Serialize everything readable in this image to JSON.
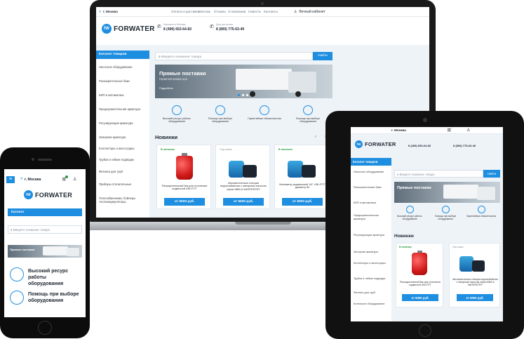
{
  "brand": {
    "logo_text": "FORWATER",
    "badge_text": "fW",
    "accent": "#1e8ee0",
    "green": "#2a9b42"
  },
  "laptop": {
    "city": "г. Москва",
    "top_links": [
      "Оплата и доставка",
      "Монтаж",
      "Отзывы",
      "О компании",
      "Новости",
      "Контакты"
    ],
    "account": "Личный кабинет",
    "phone1": {
      "label": "Магазин в Москве",
      "number": "8 (499) 653-64-83"
    },
    "phone2": {
      "label": "Для регионов",
      "number": "8 (800) 775-63-49"
    },
    "catalog_label": "Каталог товаров",
    "sidebar_items": [
      "Насосное оборудование",
      "Расширительные баки",
      "КИП и автоматика",
      "Предохранительная арматура",
      "Регулирующая арматура",
      "Запорная арматура",
      "Коллекторы и аксессуары",
      "Трубки и гибкие подводки",
      "Фитинги для труб",
      "Приборы отопительные",
      "Теплообменники, бойлеры теплоаккумуляторы"
    ],
    "search_placeholder": "Введите название товара",
    "search_button": "Найти",
    "banner_title": "Прямые поставки",
    "banner_subtitle": "Гарантия низких цен",
    "banner_more": "Подробнее",
    "features": [
      "Высокий ресурс работы оборудования",
      "Помощь при выборе оборудования",
      "Гарантийные обязательства",
      "Помощь при выборе оборудования"
    ],
    "new_title": "Новинки",
    "products": [
      {
        "tag": "В наличии",
        "name": "Расширительный бак для отопления подвесной UNI-FITT",
        "price": "от 5000 руб."
      },
      {
        "tag": "Под заказ",
        "name": "Автоматическая станция водоснабжения с напорным насосом серии КВМ-А WATERSTRY",
        "price": "от 5000 руб."
      },
      {
        "tag": "В наличии",
        "name": "Манометр радиальный 1/4\" UNI-FITT диаметр 50",
        "price": "от 5000 руб."
      }
    ]
  },
  "tablet": {
    "city": "г. Москва",
    "phone1": "8 (499) 653-64-83",
    "phone2": "8 (800) 775-63-49",
    "catalog_label": "Каталог товаров",
    "search_placeholder": "Введите название товара",
    "search_button": "Найти",
    "sidebar_items": [
      "Насосное оборудование",
      "Расширительные баки",
      "КИП и автоматика",
      "Предохранительная арматура",
      "Регулирующая арматура",
      "Запорная арматура",
      "Коллекторы и аксессуары",
      "Трубки и гибкие подводки",
      "Фитинги для труб",
      "Котельное оборудование"
    ],
    "banner_title": "Прямые поставки",
    "features": [
      "Высокий ресурс работы оборудования",
      "Помощь при выборе оборудования",
      "Гарантийные обязательства"
    ],
    "new_title": "Новинки",
    "products": [
      {
        "tag": "В наличии",
        "name": "Расширительный бак для отопления подвесной UNI-FITT",
        "price": "от 5000 руб."
      },
      {
        "tag": "Под заказ",
        "name": "Автоматическая станция водоснабжения с напорным насосом серии КВМ-А WATERSTRY",
        "price": "от 5000 руб."
      }
    ]
  },
  "phone": {
    "city": "г. Москва",
    "catalog_label": "Каталог",
    "search_placeholder": "Введите название товара",
    "banner_title": "Прямые поставки",
    "features": [
      "Высокий ресурс работы оборудования",
      "Помощь при выборе оборудования"
    ]
  }
}
